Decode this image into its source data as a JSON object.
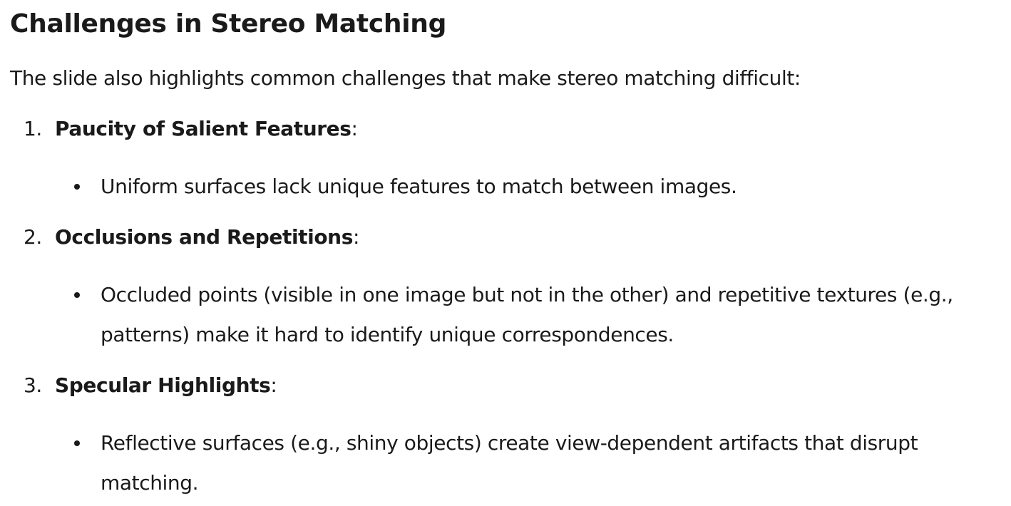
{
  "title": "Challenges in Stereo Matching",
  "intro": "The slide also highlights common challenges that make stereo matching difficult:",
  "items": [
    {
      "number": "1.",
      "title": "Paucity of Salient Features",
      "suffix": ":",
      "bullet": "Uniform surfaces lack unique features to match between images."
    },
    {
      "number": "2.",
      "title": "Occlusions and Repetitions",
      "suffix": ":",
      "bullet": "Occluded points (visible in one image but not in the other) and repetitive textures (e.g., patterns) make it hard to identify unique correspondences."
    },
    {
      "number": "3.",
      "title": "Specular Highlights",
      "suffix": ":",
      "bullet": "Reflective surfaces (e.g., shiny objects) create view-dependent artifacts that disrupt matching."
    }
  ]
}
